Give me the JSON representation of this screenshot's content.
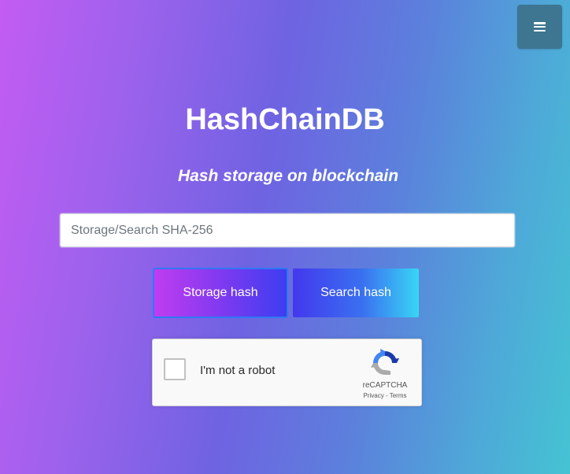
{
  "header": {
    "menu_icon": "hamburger-menu-icon",
    "menu_color": "#3e7590"
  },
  "hero": {
    "title": "HashChainDB",
    "subtitle": "Hash storage on blockchain"
  },
  "search": {
    "placeholder": "Storage/Search SHA-256",
    "value": ""
  },
  "actions": {
    "storage_label": "Storage hash",
    "search_label": "Search hash"
  },
  "captcha": {
    "label": "I'm not a robot",
    "brand": "reCAPTCHA",
    "privacy_label": "Privacy",
    "separator": "-",
    "terms_label": "Terms",
    "logo_icon": "recaptcha-logo-icon",
    "checked": false
  },
  "colors": {
    "gradient_start": "#c35cf2",
    "gradient_mid": "#6f63e2",
    "gradient_end": "#45c3d3",
    "storage_button": "#7a3af0",
    "search_button": "#3a70f0"
  }
}
